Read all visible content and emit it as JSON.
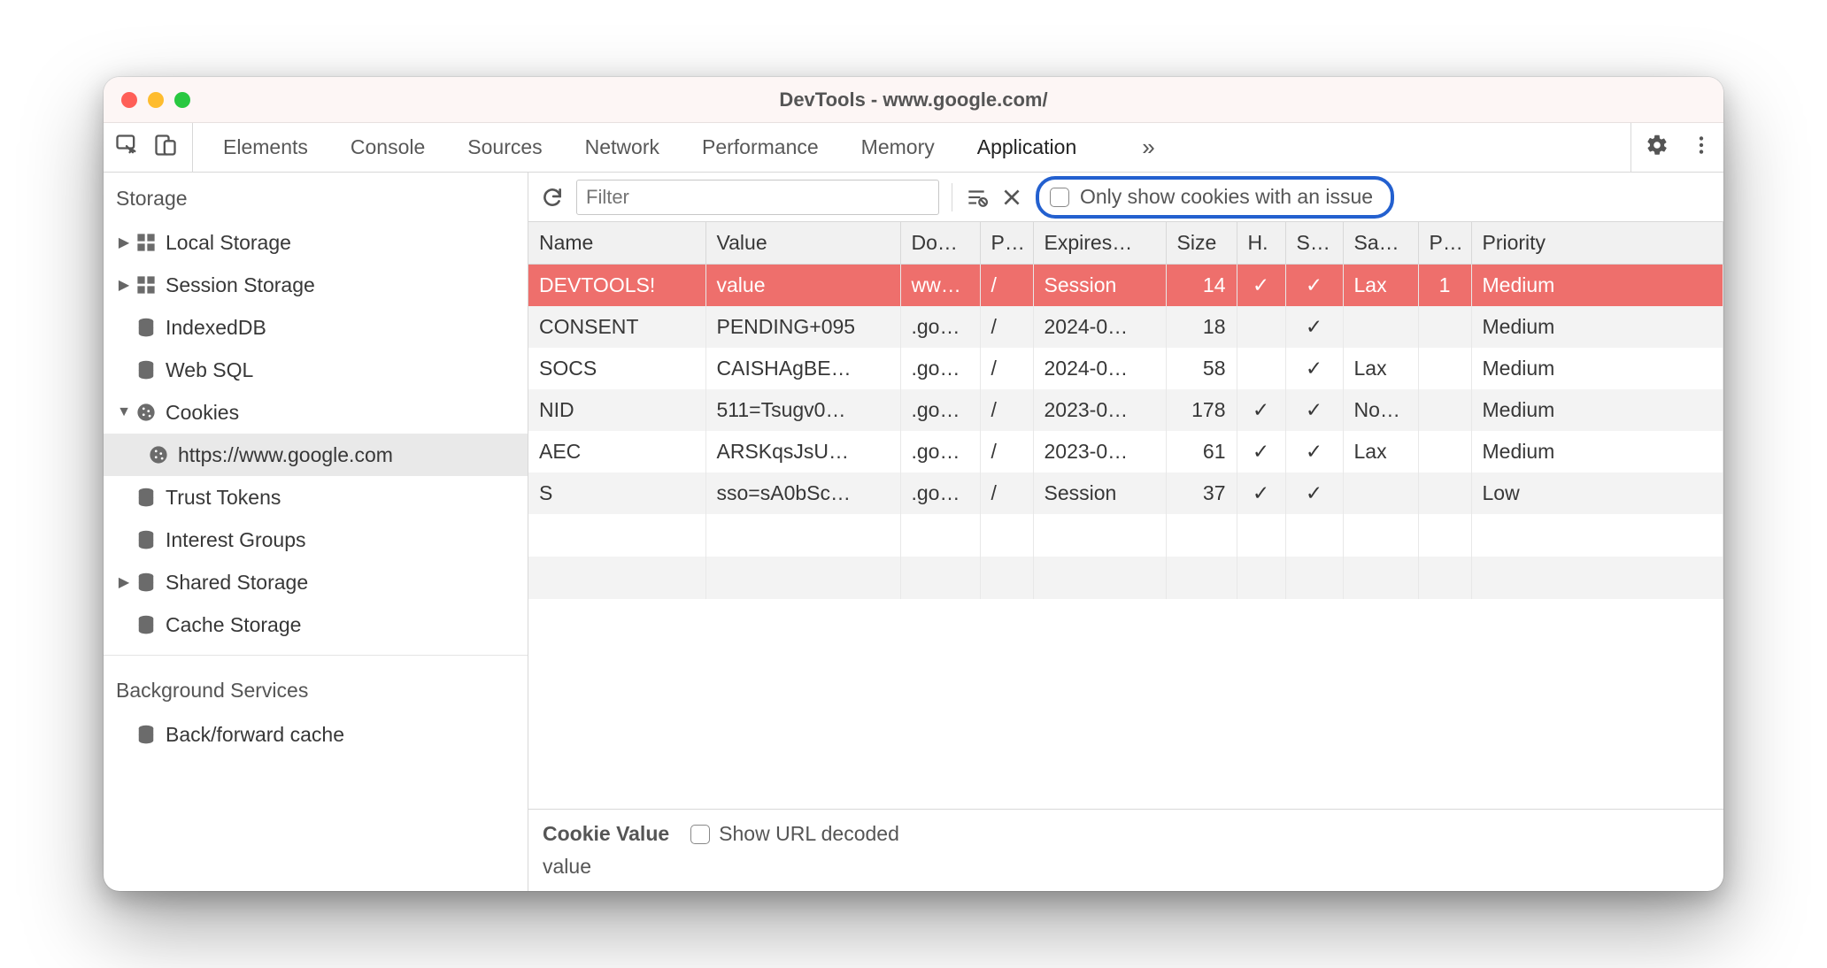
{
  "window": {
    "title": "DevTools - www.google.com/"
  },
  "tabs": {
    "list": [
      "Elements",
      "Console",
      "Sources",
      "Network",
      "Performance",
      "Memory",
      "Application"
    ],
    "active": "Application",
    "more_glyph": "»"
  },
  "toolbar": {
    "filter_placeholder": "Filter",
    "only_issues_label": "Only show cookies with an issue"
  },
  "sidebar": {
    "storage_title": "Storage",
    "items": [
      {
        "label": "Local Storage",
        "icon": "grid",
        "arrow": "▶"
      },
      {
        "label": "Session Storage",
        "icon": "grid",
        "arrow": "▶"
      },
      {
        "label": "IndexedDB",
        "icon": "db",
        "arrow": ""
      },
      {
        "label": "Web SQL",
        "icon": "db",
        "arrow": ""
      },
      {
        "label": "Cookies",
        "icon": "cookie",
        "arrow": "▼",
        "children": [
          {
            "label": "https://www.google.com",
            "icon": "cookie"
          }
        ]
      },
      {
        "label": "Trust Tokens",
        "icon": "db",
        "arrow": ""
      },
      {
        "label": "Interest Groups",
        "icon": "db",
        "arrow": ""
      },
      {
        "label": "Shared Storage",
        "icon": "db",
        "arrow": "▶"
      },
      {
        "label": "Cache Storage",
        "icon": "db",
        "arrow": ""
      }
    ],
    "bg_title": "Background Services",
    "bg_items": [
      {
        "label": "Back/forward cache",
        "icon": "db"
      }
    ]
  },
  "columns": {
    "name": "Name",
    "value": "Value",
    "domain": "Do…",
    "path": "P…",
    "expires": "Expires…",
    "size": "Size",
    "http": "H.",
    "secure": "S…",
    "samesite": "Sa…",
    "party": "P…",
    "priority": "Priority"
  },
  "rows": [
    {
      "name": "DEVTOOLS!",
      "value": "value",
      "domain": "ww…",
      "path": "/",
      "expires": "Session",
      "size": "14",
      "http": "✓",
      "secure": "✓",
      "samesite": "Lax",
      "party": "1",
      "priority": "Medium",
      "danger": true
    },
    {
      "name": "CONSENT",
      "value": "PENDING+095",
      "domain": ".go…",
      "path": "/",
      "expires": "2024-0…",
      "size": "18",
      "http": "",
      "secure": "✓",
      "samesite": "",
      "party": "",
      "priority": "Medium"
    },
    {
      "name": "SOCS",
      "value": "CAISHAgBE…",
      "domain": ".go…",
      "path": "/",
      "expires": "2024-0…",
      "size": "58",
      "http": "",
      "secure": "✓",
      "samesite": "Lax",
      "party": "",
      "priority": "Medium"
    },
    {
      "name": "NID",
      "value": "511=Tsugv0…",
      "domain": ".go…",
      "path": "/",
      "expires": "2023-0…",
      "size": "178",
      "http": "✓",
      "secure": "✓",
      "samesite": "No…",
      "party": "",
      "priority": "Medium"
    },
    {
      "name": "AEC",
      "value": "ARSKqsJsU…",
      "domain": ".go…",
      "path": "/",
      "expires": "2023-0…",
      "size": "61",
      "http": "✓",
      "secure": "✓",
      "samesite": "Lax",
      "party": "",
      "priority": "Medium"
    },
    {
      "name": "S",
      "value": "sso=sA0bSc…",
      "domain": ".go…",
      "path": "/",
      "expires": "Session",
      "size": "37",
      "http": "✓",
      "secure": "✓",
      "samesite": "",
      "party": "",
      "priority": "Low"
    }
  ],
  "detail": {
    "title": "Cookie Value",
    "show_decoded_label": "Show URL decoded",
    "value": "value"
  },
  "icons": {
    "check": "✓"
  }
}
